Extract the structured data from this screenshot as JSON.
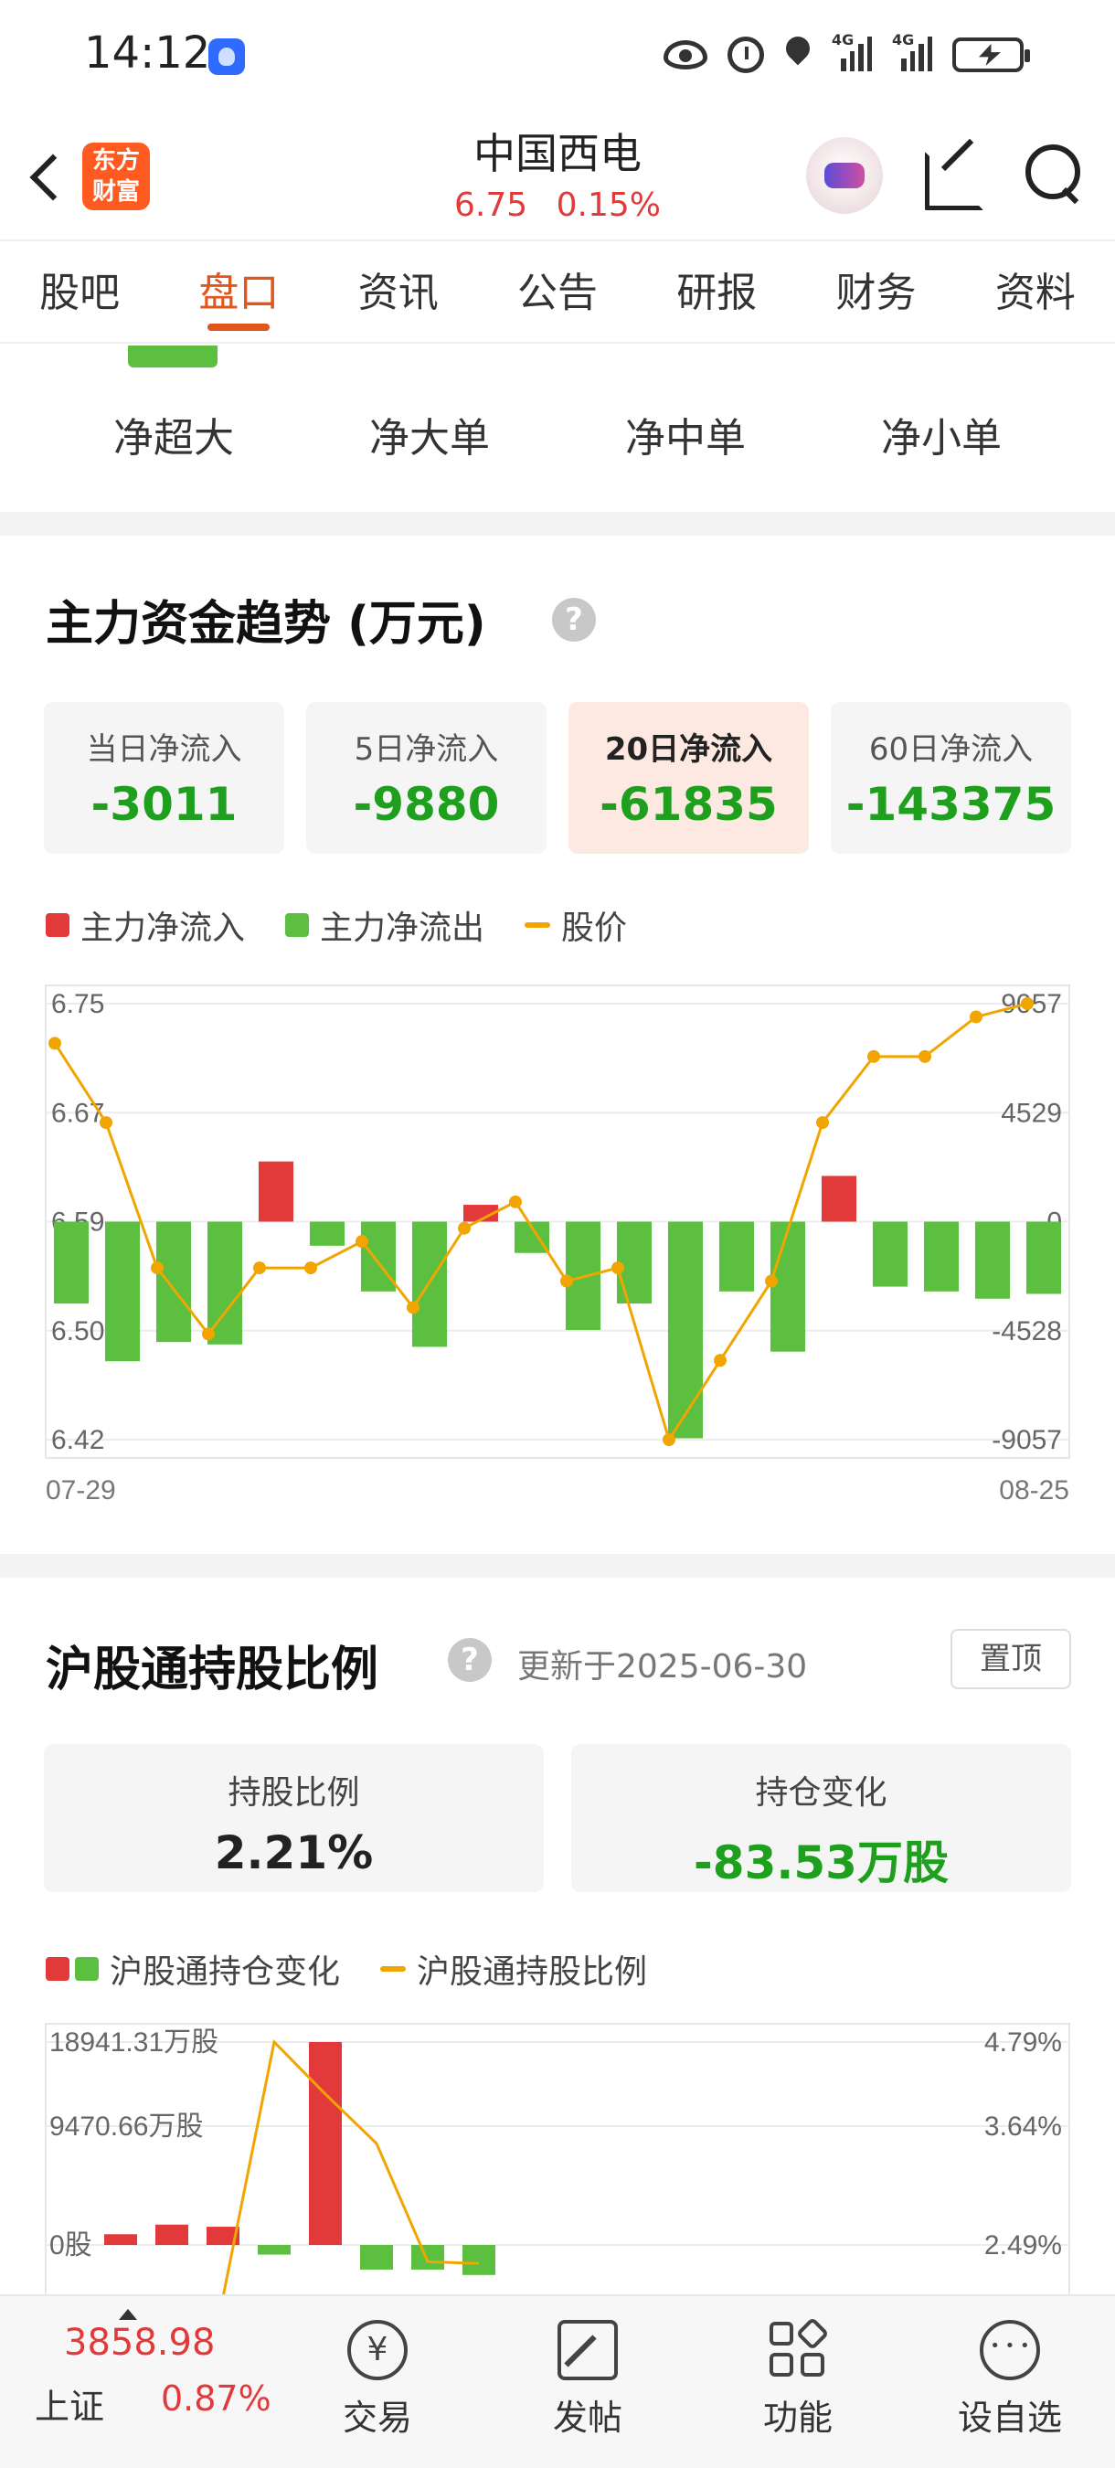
{
  "status_bar": {
    "time": "14:12",
    "signal1_label": "4G",
    "signal2_label": "4G",
    "icons": [
      "app-icon",
      "eye-icon",
      "alarm-icon",
      "location-icon",
      "signal-icon",
      "signal-icon",
      "battery-charging-icon"
    ]
  },
  "header": {
    "logo_line1": "东方",
    "logo_line2": "财富",
    "stock_name": "中国西电",
    "price": "6.75",
    "change_pct": "0.15%",
    "icons": [
      "back-icon",
      "robot-avatar-icon",
      "share-icon",
      "search-icon"
    ]
  },
  "tabs": [
    {
      "label": "股吧",
      "active": false
    },
    {
      "label": "盘口",
      "active": true
    },
    {
      "label": "资讯",
      "active": false
    },
    {
      "label": "公告",
      "active": false
    },
    {
      "label": "研报",
      "active": false
    },
    {
      "label": "财务",
      "active": false
    },
    {
      "label": "资料",
      "active": false
    }
  ],
  "subcats": [
    "净超大",
    "净大单",
    "净中单",
    "净小单"
  ],
  "section1": {
    "title": "主力资金趋势 (万元)",
    "help": "?",
    "cards": [
      {
        "label": "当日净流入",
        "value": "-3011"
      },
      {
        "label": "5日净流入",
        "value": "-9880"
      },
      {
        "label": "20日净流入",
        "value": "-61835"
      },
      {
        "label": "60日净流入",
        "value": "-143375"
      }
    ],
    "legend": [
      "主力净流入",
      "主力净流出",
      "股价"
    ]
  },
  "section2": {
    "title": "沪股通持股比例",
    "help": "?",
    "update": "更新于2025-06-30",
    "pin_label": "置顶",
    "card_ratio_label": "持股比例",
    "card_ratio_value": "2.21%",
    "card_change_label": "持仓变化",
    "card_change_value": "-83.53万股",
    "legend": [
      "沪股通持仓变化",
      "沪股通持股比例"
    ]
  },
  "bottom_bar": {
    "index_value": "3858.98",
    "index_name": "上证",
    "index_pct": "0.87%",
    "items": [
      {
        "label": "交易",
        "icon": "trade-icon"
      },
      {
        "label": "发帖",
        "icon": "post-icon"
      },
      {
        "label": "功能",
        "icon": "function-icon"
      },
      {
        "label": "设自选",
        "icon": "more-icon"
      }
    ]
  },
  "colors": {
    "accent": "#e0561b",
    "up": "#e23a3a",
    "down": "#5cbf3f",
    "price_line": "#f0a500"
  },
  "chart_data": [
    {
      "type": "bar",
      "title": "主力资金趋势 (万元)",
      "x_start": "07-29",
      "x_end": "08-25",
      "left_ticks": [
        "6.75",
        "6.67",
        "6.59",
        "6.50",
        "6.42"
      ],
      "right_ticks": [
        "9057",
        "4529",
        "0",
        "-4528",
        "-9057"
      ],
      "ylim_right": [
        -9057,
        9057
      ],
      "ylim_left": [
        6.42,
        6.75
      ],
      "series": [
        {
          "name": "主力净流入/主力净流出",
          "values": [
            -3400,
            -5800,
            -5000,
            -5100,
            2500,
            -1000,
            -2900,
            -5200,
            700,
            -1300,
            -4500,
            -3400,
            -9000,
            -2900,
            -5400,
            1900,
            -2700,
            -2900,
            -3200,
            -3000
          ]
        },
        {
          "name": "股价",
          "values": [
            6.72,
            6.66,
            6.55,
            6.5,
            6.55,
            6.55,
            6.57,
            6.52,
            6.58,
            6.6,
            6.54,
            6.55,
            6.42,
            6.48,
            6.54,
            6.66,
            6.71,
            6.71,
            6.74,
            6.75
          ]
        }
      ],
      "grid": true
    },
    {
      "type": "bar",
      "title": "沪股通持股比例",
      "left_ticks": [
        "18941.31万股",
        "9470.66万股",
        "0股"
      ],
      "right_ticks": [
        "4.79%",
        "3.64%",
        "2.49%"
      ],
      "ylim_left_wan_gu": [
        0,
        18941.31
      ],
      "ylim_right_pct": [
        2.49,
        4.79
      ],
      "series": [
        {
          "name": "沪股通持仓变化",
          "values": [
            1000,
            1900,
            1700,
            -900,
            18941,
            -2300,
            -2300,
            -2800
          ]
        },
        {
          "name": "沪股通持股比例",
          "values": [
            1.9,
            1.9,
            1.9,
            1.9,
            4.79,
            4.2,
            3.64,
            2.3,
            2.28
          ]
        }
      ]
    }
  ]
}
